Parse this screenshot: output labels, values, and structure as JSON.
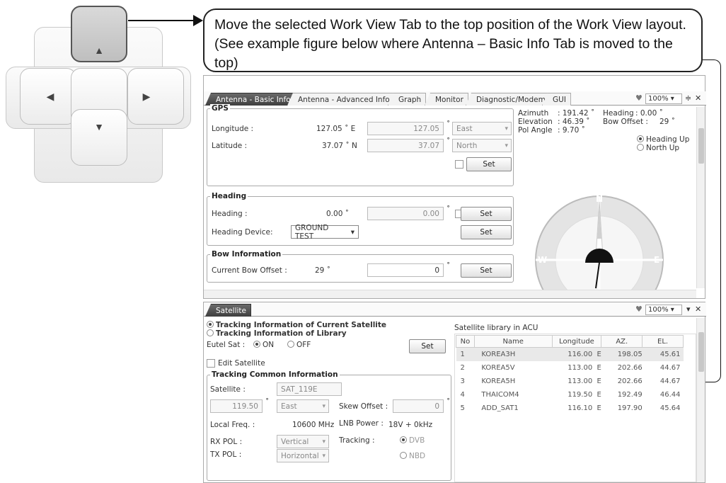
{
  "callout": {
    "text": "Move the selected Work View Tab to the top position of the Work View layout. (See example figure below where Antenna – Basic Info Tab is moved to the top)"
  },
  "top_panel": {
    "tabs": [
      {
        "label": "Antenna - Basic Info."
      },
      {
        "label": "Antenna - Advanced Info."
      },
      {
        "label": "Graph"
      },
      {
        "label": "Monitor"
      },
      {
        "label": "Diagnostic/Modem"
      },
      {
        "label": "GUI"
      }
    ],
    "zoom": "100%",
    "gps": {
      "title": "GPS",
      "longitude_label": "Longitude :",
      "longitude_value": "127.05 ˚ E",
      "longitude_input": "127.05",
      "longitude_dir": "East",
      "latitude_label": "Latitude :",
      "latitude_value": "37.07 ˚ N",
      "latitude_input": "37.07",
      "latitude_dir": "North",
      "set_label": "Set"
    },
    "heading": {
      "title": "Heading",
      "heading_label": "Heading :",
      "heading_value": "0.00 ˚",
      "heading_input": "0.00",
      "device_label": "Heading Device:",
      "device_value": "GROUND TEST",
      "set_label": "Set",
      "set2_label": "Set"
    },
    "bow": {
      "title": "Bow Information",
      "label": "Current Bow Offset :",
      "value": "29 ˚",
      "input": "0",
      "set_label": "Set"
    },
    "status": {
      "azimuth_label": "Azimuth",
      "azimuth_value": ": 191.42 ˚",
      "elevation_label": "Elevation",
      "elevation_value": ": 46.39 ˚",
      "pol_label": "Pol Angle",
      "pol_value": ": 9.70 ˚",
      "heading_label": "Heading",
      "heading_value": ": 0.00 ˚",
      "bow_label": "Bow Offset :",
      "bow_value": "29 ˚",
      "heading_up": "Heading Up",
      "north_up": "North Up"
    },
    "compass": {
      "n": "N",
      "w": "W",
      "e": "E"
    }
  },
  "bottom_panel": {
    "tab": "Satellite",
    "zoom": "100%",
    "tracking_current": "Tracking Information of Current Satellite",
    "tracking_library": "Tracking Information of Library",
    "eutel_label": "Eutel Sat :",
    "on_label": "ON",
    "off_label": "OFF",
    "set_label": "Set",
    "edit_satellite": "Edit Satellite",
    "common_title": "Tracking Common  Information",
    "satellite_label": "Satellite :",
    "satellite_value": "SAT_119E",
    "longitude_value": "119.50",
    "direction_value": "East",
    "skew_label": "Skew Offset :",
    "skew_value": "0",
    "local_freq_label": "Local Freq. :",
    "local_freq_value": "10600 MHz",
    "lnb_label": "LNB Power :",
    "lnb_value": "18V + 0kHz",
    "rx_label": "RX POL :",
    "rx_value": "Vertical",
    "tracking_label": "Tracking :",
    "dvb_label": "DVB",
    "tx_label": "TX POL :",
    "tx_value": "Horizontal",
    "nbd_label": "NBD",
    "library_title": "Satellite library in ACU",
    "columns": [
      "No",
      "Name",
      "Longitude",
      "AZ.",
      "EL."
    ],
    "rows": [
      [
        "1",
        "KOREA3H",
        "116.00  E",
        "198.05",
        "45.61"
      ],
      [
        "2",
        "KOREA5V",
        "113.00  E",
        "202.66",
        "44.67"
      ],
      [
        "3",
        "KOREA5H",
        "113.00  E",
        "202.66",
        "44.67"
      ],
      [
        "4",
        "THAICOM4",
        "119.50  E",
        "192.49",
        "46.44"
      ],
      [
        "5",
        "ADD_SAT1",
        "116.10  E",
        "197.90",
        "45.64"
      ]
    ]
  },
  "colors": {
    "active_tab": "#4a4a4a",
    "pad_selected": "#c8c8c8"
  }
}
